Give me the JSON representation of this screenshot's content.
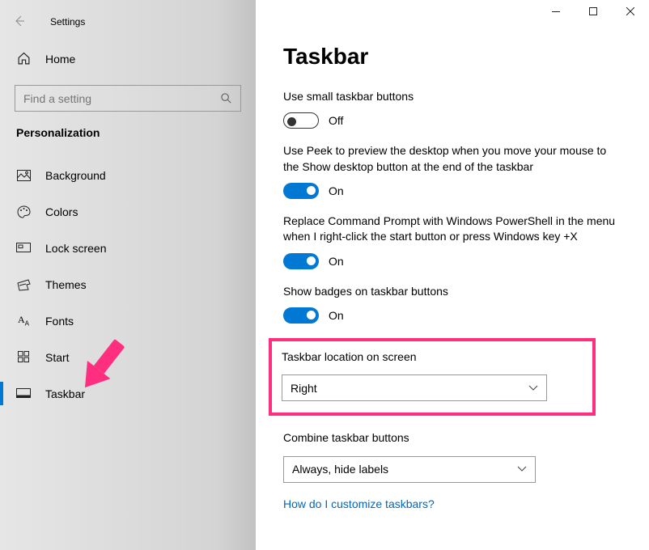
{
  "header": {
    "app_name": "Settings"
  },
  "sidebar": {
    "home_label": "Home",
    "search_placeholder": "Find a setting",
    "section_title": "Personalization",
    "items": [
      {
        "label": "Background",
        "icon": "image-icon"
      },
      {
        "label": "Colors",
        "icon": "palette-icon"
      },
      {
        "label": "Lock screen",
        "icon": "lockscreen-icon"
      },
      {
        "label": "Themes",
        "icon": "themes-icon"
      },
      {
        "label": "Fonts",
        "icon": "fonts-icon"
      },
      {
        "label": "Start",
        "icon": "start-icon"
      },
      {
        "label": "Taskbar",
        "icon": "taskbar-icon"
      }
    ],
    "active_index": 6
  },
  "main": {
    "title": "Taskbar",
    "settings": {
      "small_buttons": {
        "label": "Use small taskbar buttons",
        "state": "Off",
        "on": false
      },
      "peek": {
        "label": "Use Peek to preview the desktop when you move your mouse to the Show desktop button at the end of the taskbar",
        "state": "On",
        "on": true
      },
      "powershell": {
        "label": "Replace Command Prompt with Windows PowerShell in the menu when I right-click the start button or press Windows key +X",
        "state": "On",
        "on": true
      },
      "badges": {
        "label": "Show badges on taskbar buttons",
        "state": "On",
        "on": true
      },
      "location": {
        "label": "Taskbar location on screen",
        "value": "Right"
      },
      "combine": {
        "label": "Combine taskbar buttons",
        "value": "Always, hide labels"
      },
      "help_link": "How do I customize taskbars?"
    }
  }
}
